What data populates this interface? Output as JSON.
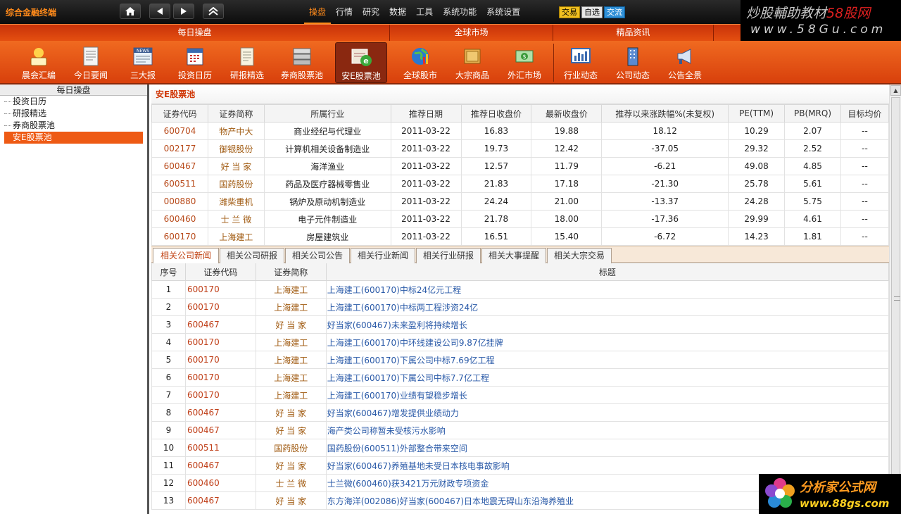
{
  "app_title": "综合金融终端",
  "nav": {
    "home_icon": "home-icon",
    "back_icon": "triangle-left-icon",
    "forward_icon": "triangle-right-icon",
    "collapse_icon": "double-chevron-up-icon"
  },
  "menu": [
    "操盘",
    "行情",
    "研究",
    "数据",
    "工具",
    "系统功能",
    "系统设置"
  ],
  "quick_buttons": [
    "交易",
    "自选",
    "交流"
  ],
  "watermark_top": {
    "line1_a": "炒股輔助教材",
    "line1_b": "58股网",
    "line2": "www.58Gu.com"
  },
  "section_groups": [
    "每日操盘",
    "全球市场",
    "精品资讯"
  ],
  "toolbar": [
    {
      "label": "晨会汇编",
      "icon": "morning-meeting-icon"
    },
    {
      "label": "今日要闻",
      "icon": "newspaper-icon"
    },
    {
      "label": "三大报",
      "icon": "news-icon"
    },
    {
      "label": "投资日历",
      "icon": "calendar-icon"
    },
    {
      "label": "研报精选",
      "icon": "report-icon"
    },
    {
      "label": "券商股票池",
      "icon": "broker-pool-icon"
    },
    {
      "label": "安E股票池",
      "icon": "e-pool-icon"
    },
    {
      "label": "全球股市",
      "icon": "globe-icon"
    },
    {
      "label": "大宗商品",
      "icon": "commodity-icon"
    },
    {
      "label": "外汇市场",
      "icon": "forex-icon"
    },
    {
      "label": "行业动态",
      "icon": "industry-chart-icon"
    },
    {
      "label": "公司动态",
      "icon": "company-building-icon"
    },
    {
      "label": "公告全景",
      "icon": "announcement-icon"
    }
  ],
  "left_panel": {
    "title": "每日操盘",
    "items": [
      "投资日历",
      "研报精选",
      "券商股票池",
      "安E股票池"
    ]
  },
  "main": {
    "title": "安E股票池",
    "headers": [
      "证券代码",
      "证券简称",
      "所属行业",
      "推荐日期",
      "推荐日收盘价",
      "最新收盘价",
      "推荐以来涨跌幅%(未复权)",
      "PE(TTM)",
      "PB(MRQ)",
      "目标均价"
    ],
    "rows": [
      [
        "600704",
        "物产中大",
        "商业经纪与代理业",
        "2011-03-22",
        "16.83",
        "19.88",
        "18.12",
        "10.29",
        "2.07",
        "--"
      ],
      [
        "002177",
        "御银股份",
        "计算机相关设备制造业",
        "2011-03-22",
        "19.73",
        "12.42",
        "-37.05",
        "29.32",
        "2.52",
        "--"
      ],
      [
        "600467",
        "好 当 家",
        "海洋渔业",
        "2011-03-22",
        "12.57",
        "11.79",
        "-6.21",
        "49.08",
        "4.85",
        "--"
      ],
      [
        "600511",
        "国药股份",
        "药品及医疗器械零售业",
        "2011-03-22",
        "21.83",
        "17.18",
        "-21.30",
        "25.78",
        "5.61",
        "--"
      ],
      [
        "000880",
        "潍柴重机",
        "锅炉及原动机制造业",
        "2011-03-22",
        "24.24",
        "21.00",
        "-13.37",
        "24.28",
        "5.75",
        "--"
      ],
      [
        "600460",
        "士 兰 微",
        "电子元件制造业",
        "2011-03-22",
        "21.78",
        "18.00",
        "-17.36",
        "29.99",
        "4.61",
        "--"
      ],
      [
        "600170",
        "上海建工",
        "房屋建筑业",
        "2011-03-22",
        "16.51",
        "15.40",
        "-6.72",
        "14.23",
        "1.81",
        "--"
      ]
    ]
  },
  "tabs": [
    "相关公司新闻",
    "相关公司研报",
    "相关公司公告",
    "相关行业新闻",
    "相关行业研报",
    "相关大事提醒",
    "相关大宗交易"
  ],
  "news": {
    "headers": [
      "序号",
      "证券代码",
      "证券简称",
      "标题"
    ],
    "rows": [
      [
        "1",
        "600170",
        "上海建工",
        "上海建工(600170)中标24亿元工程"
      ],
      [
        "2",
        "600170",
        "上海建工",
        "上海建工(600170)中标两工程涉资24亿"
      ],
      [
        "3",
        "600467",
        "好 当 家",
        "好当家(600467)未来盈利将持续增长"
      ],
      [
        "4",
        "600170",
        "上海建工",
        "上海建工(600170)中环线建设公司9.87亿挂牌"
      ],
      [
        "5",
        "600170",
        "上海建工",
        "上海建工(600170)下属公司中标7.69亿工程"
      ],
      [
        "6",
        "600170",
        "上海建工",
        "上海建工(600170)下属公司中标7.7亿工程"
      ],
      [
        "7",
        "600170",
        "上海建工",
        "上海建工(600170)业绩有望稳步增长"
      ],
      [
        "8",
        "600467",
        "好 当 家",
        "好当家(600467)增发提供业绩动力"
      ],
      [
        "9",
        "600467",
        "好 当 家",
        "海产类公司称暂未受核污水影响"
      ],
      [
        "10",
        "600511",
        "国药股份",
        "国药股份(600511)外部整合带来空间"
      ],
      [
        "11",
        "600467",
        "好 当 家",
        "好当家(600467)养殖基地未受日本核电事故影响"
      ],
      [
        "12",
        "600460",
        "士 兰 微",
        "士兰微(600460)获3421万元财政专项资金"
      ],
      [
        "13",
        "600467",
        "好 当 家",
        "东方海洋(002086)好当家(600467)日本地震无碍山东沿海养殖业"
      ]
    ]
  },
  "watermark_bottom": {
    "line1": "分析家公式网",
    "line2": "www.88gs.com"
  }
}
